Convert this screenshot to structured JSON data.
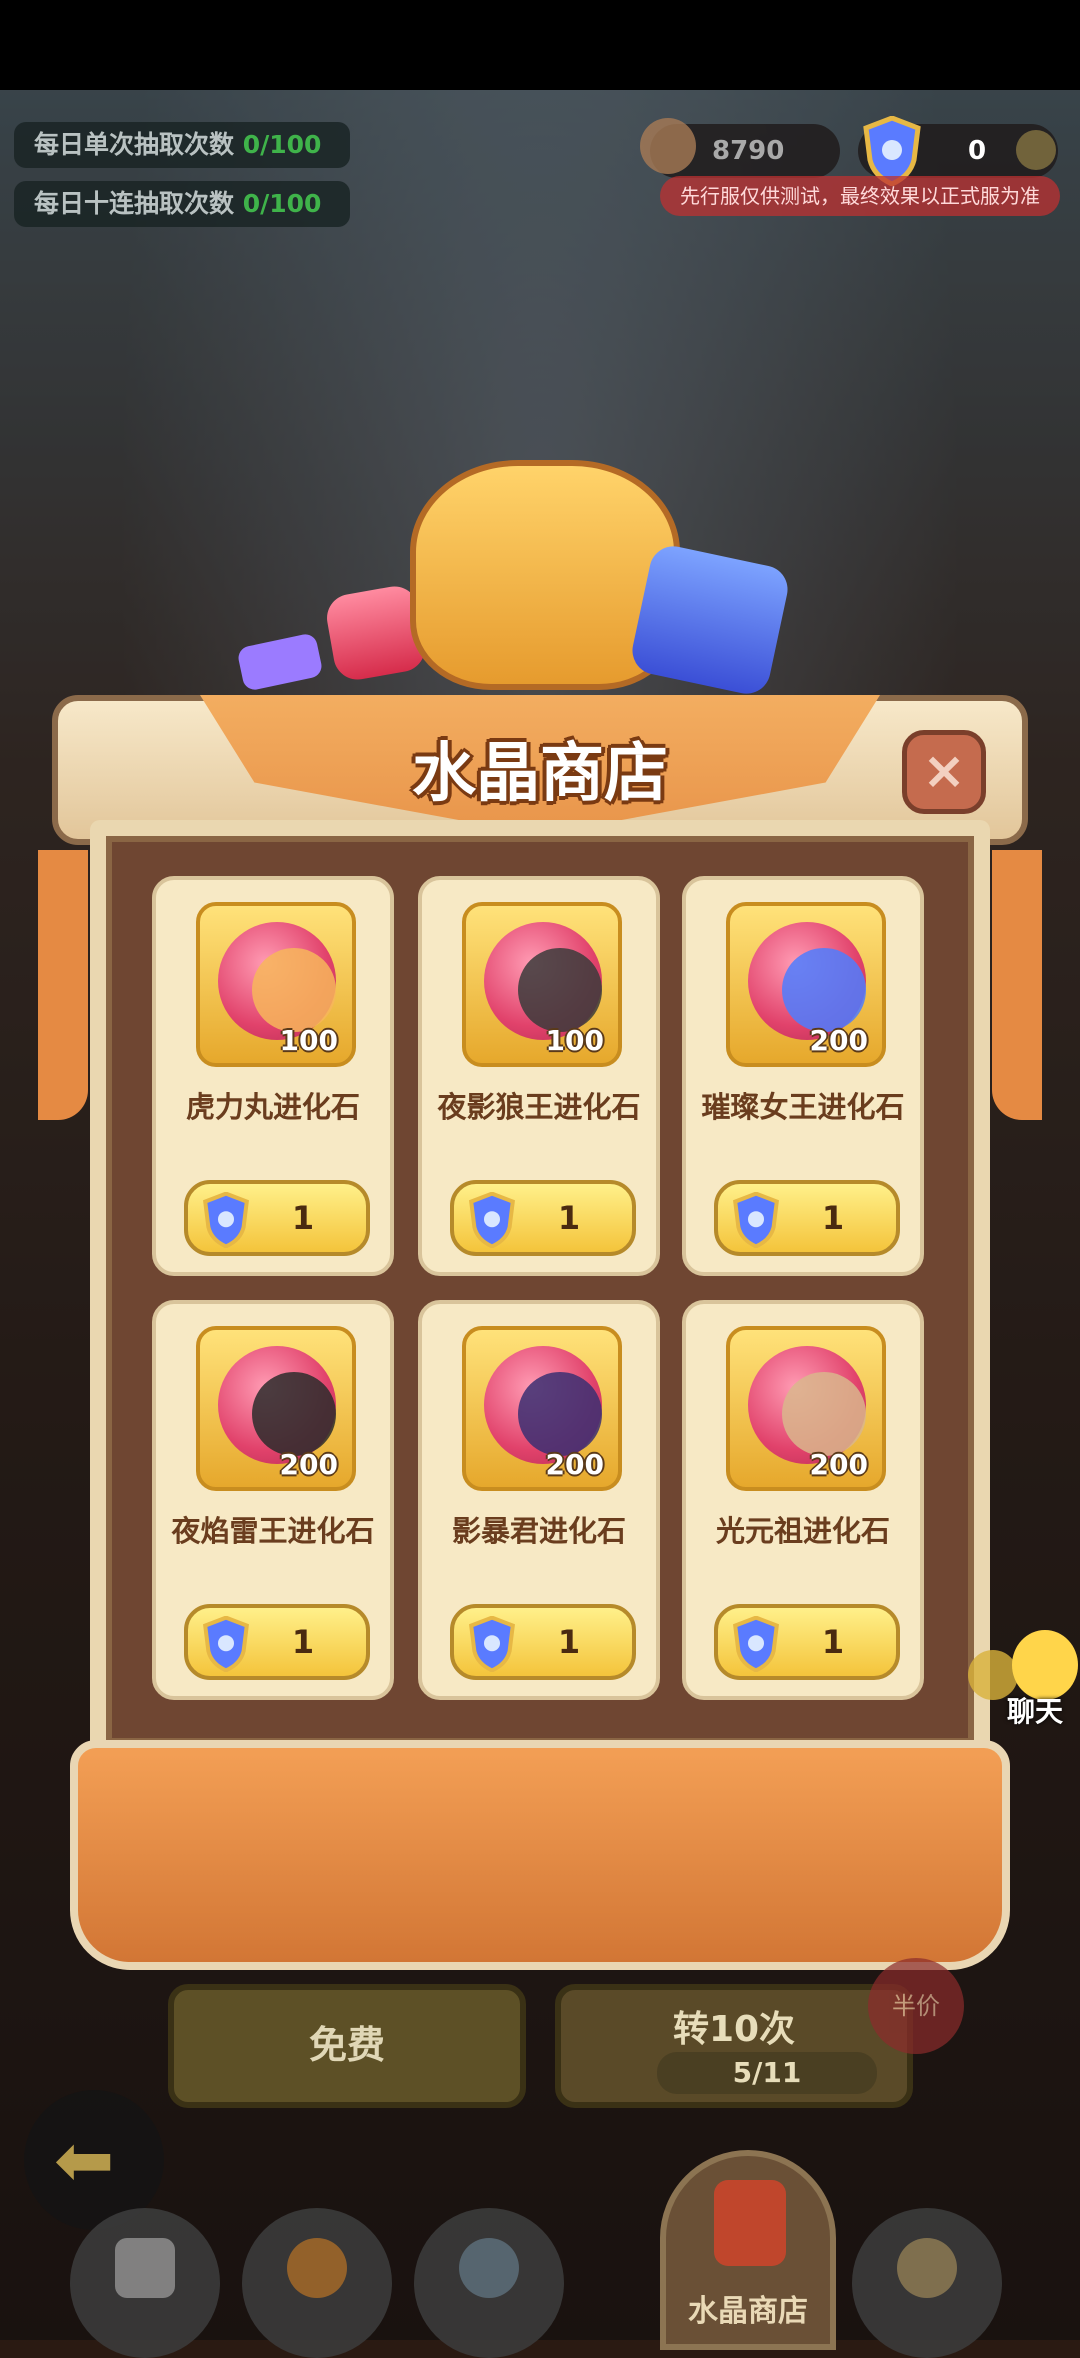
{
  "header": {
    "daily_single_label": "每日单次抽取次数",
    "daily_single_value": "0/100",
    "daily_ten_label": "每日十连抽取次数",
    "daily_ten_value": "0/100",
    "coins_value": "8790",
    "crystal_value": "0",
    "notice": "先行服仅供测试，最终效果以正式服为准"
  },
  "shop": {
    "title": "水晶商店",
    "items": [
      {
        "name": "虎力丸进化石",
        "qty": "100",
        "price": "1",
        "creature_color": "#f7b65a"
      },
      {
        "name": "夜影狼王进化石",
        "qty": "100",
        "price": "1",
        "creature_color": "#3b3b3b"
      },
      {
        "name": "璀璨女王进化石",
        "qty": "200",
        "price": "1",
        "creature_color": "#4e7cff"
      },
      {
        "name": "夜焰雷王进化石",
        "qty": "200",
        "price": "1",
        "creature_color": "#2b2b2b"
      },
      {
        "name": "影暴君进化石",
        "qty": "200",
        "price": "1",
        "creature_color": "#3b2f72"
      },
      {
        "name": "光元祖进化石",
        "qty": "200",
        "price": "1",
        "creature_color": "#d9b68c"
      }
    ]
  },
  "actions": {
    "free_label": "免费",
    "ten_label": "转10次",
    "ten_count": "5/11",
    "half_badge": "半价"
  },
  "chat_label": "聊天",
  "bottom_nav": {
    "main_tab_label": "水晶商店"
  }
}
